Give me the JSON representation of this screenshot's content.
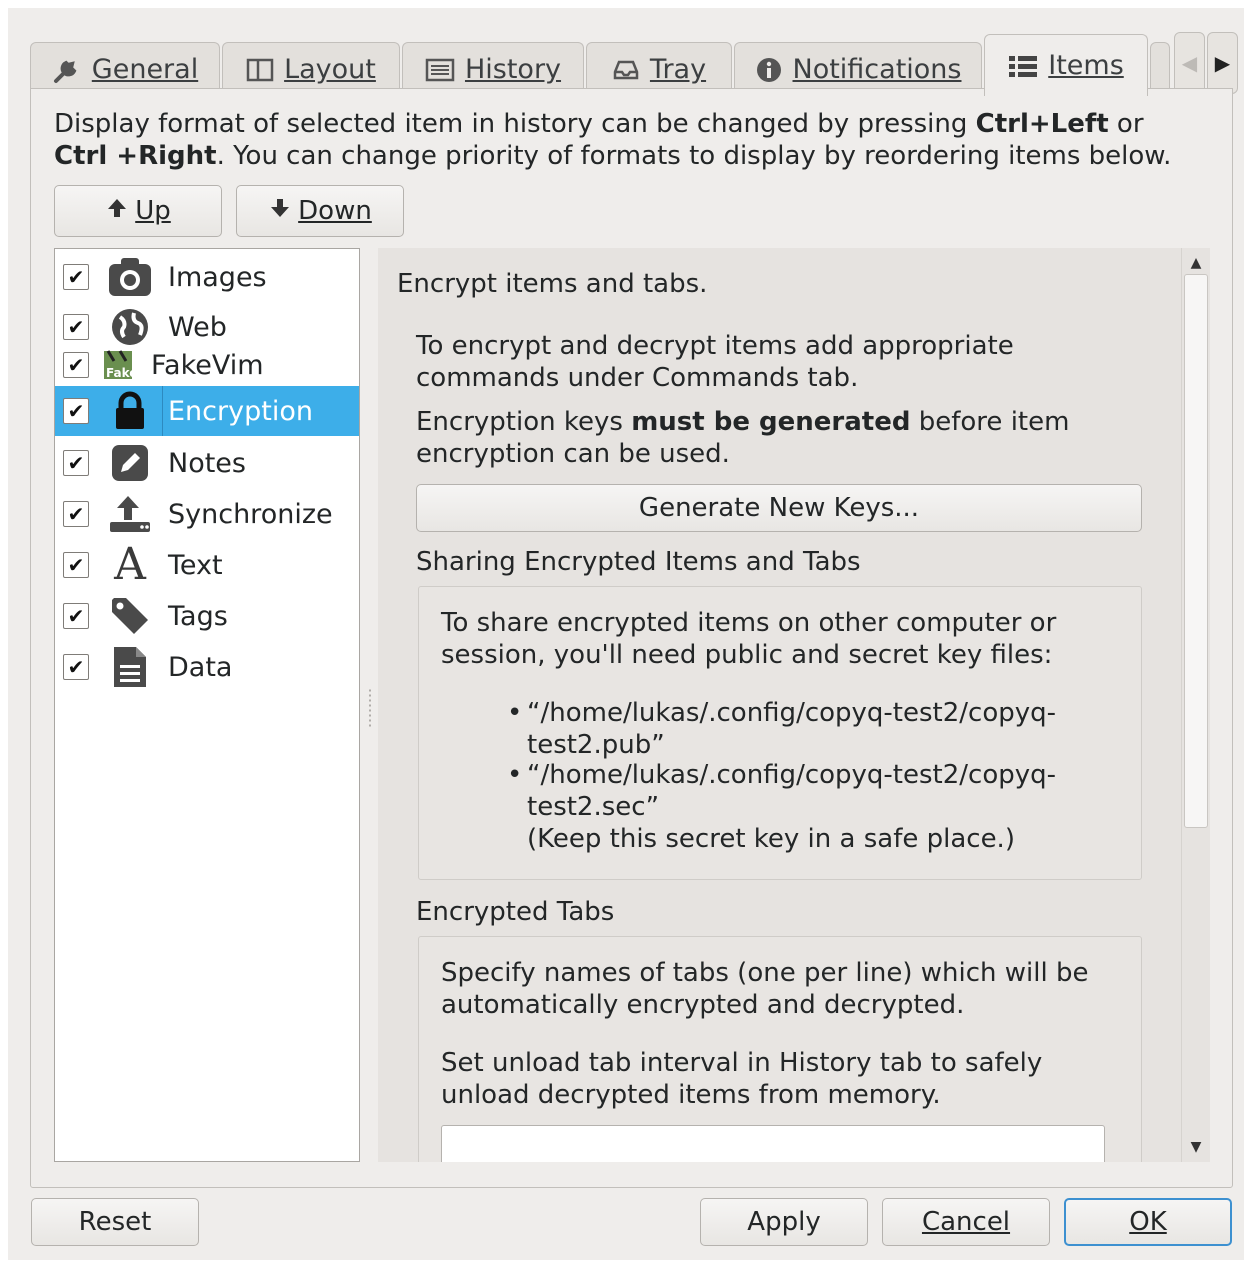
{
  "tabs": [
    {
      "label": "General",
      "icon": "wrench-icon"
    },
    {
      "label": "Layout",
      "icon": "layout-icon"
    },
    {
      "label": "History",
      "icon": "history-icon"
    },
    {
      "label": "Tray",
      "icon": "tray-icon"
    },
    {
      "label": "Notifications",
      "icon": "info-icon"
    },
    {
      "label": "Items",
      "icon": "list-icon"
    }
  ],
  "description": {
    "part1": "Display format of selected item in history can be changed by pressing ",
    "key1": "Ctrl+Left",
    "part2": " or ",
    "key2": "Ctrl +Right",
    "part3": ". You can change priority of formats to display by reordering items below."
  },
  "move": {
    "up_label": "Up",
    "down_label": "Down"
  },
  "items": [
    {
      "label": "Images",
      "icon": "camera-icon",
      "checked": true
    },
    {
      "label": "Web",
      "icon": "globe-icon",
      "checked": true
    },
    {
      "label": "FakeVim",
      "icon": "fakevim-icon",
      "checked": true
    },
    {
      "label": "Encryption",
      "icon": "lock-icon",
      "checked": true,
      "selected": true
    },
    {
      "label": "Notes",
      "icon": "pencil-icon",
      "checked": true
    },
    {
      "label": "Synchronize",
      "icon": "upload-icon",
      "checked": true
    },
    {
      "label": "Text",
      "icon": "text-icon",
      "checked": true
    },
    {
      "label": "Tags",
      "icon": "tag-icon",
      "checked": true
    },
    {
      "label": "Data",
      "icon": "document-icon",
      "checked": true
    }
  ],
  "encryption": {
    "title": "Encrypt items and tabs.",
    "info1": "To encrypt and decrypt items add appropriate commands under Commands tab.",
    "keys_text_a": "Encryption keys ",
    "keys_text_b": "must be generated",
    "keys_text_c": " before item encryption can be used.",
    "generate_label": "Generate New Keys...",
    "sharing_title": "Sharing Encrypted Items and Tabs",
    "sharing_text": "To share encrypted items on other computer or session, you'll need public and secret key files:",
    "pub_file": "“/home/lukas/.config/copyq-test2/copyq-test2.pub”",
    "sec_file": "“/home/lukas/.config/copyq-test2/copyq-test2.sec”",
    "sec_note": "(Keep this secret key in a safe place.)",
    "tabs_title": "Encrypted Tabs",
    "tabs_text1": "Specify names of tabs (one per line) which will be automatically encrypted and decrypted.",
    "tabs_text2": "Set unload tab interval in History tab to safely unload decrypted items from memory."
  },
  "footer": {
    "reset_label": "Reset",
    "apply_label": "Apply",
    "cancel_label": "Cancel",
    "ok_label": "OK"
  },
  "colors": {
    "accent": "#3daee9",
    "default_border": "#3d90d0"
  }
}
